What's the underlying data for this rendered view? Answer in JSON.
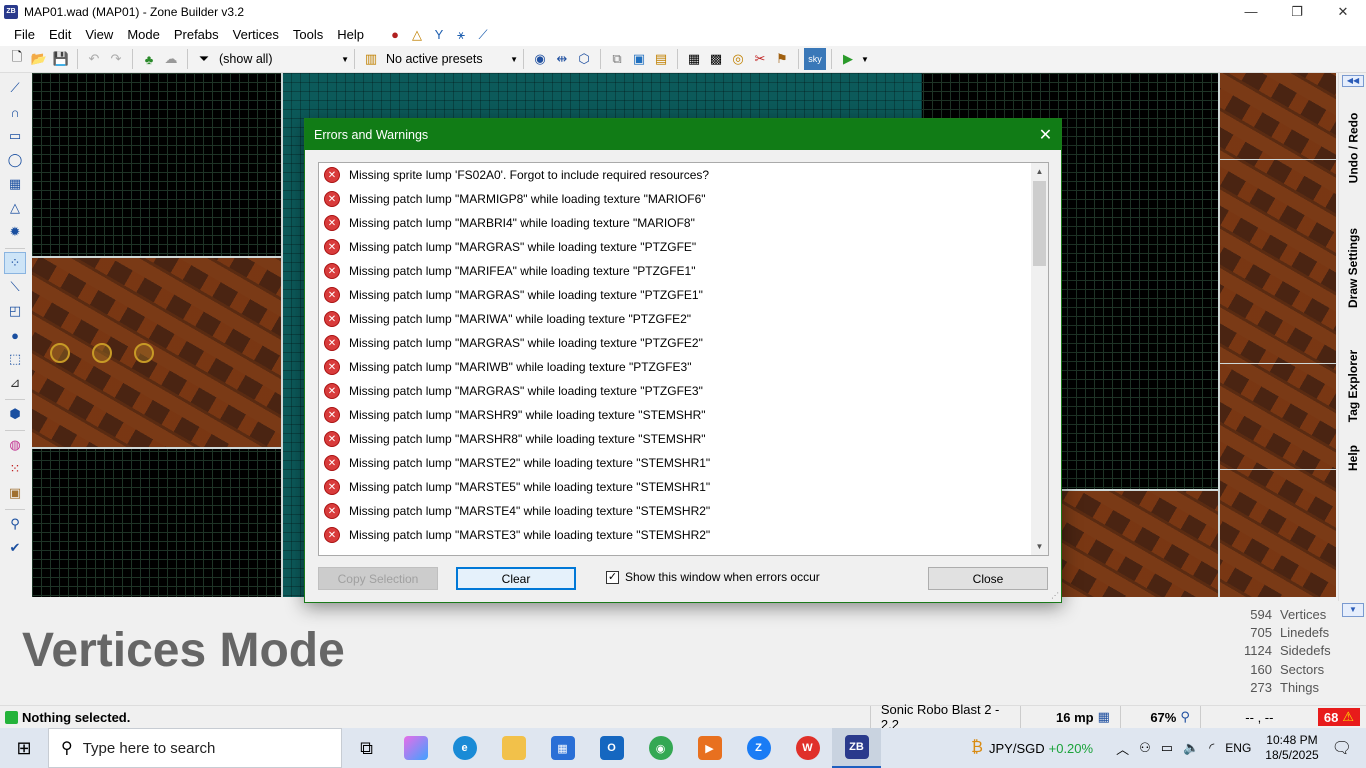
{
  "window": {
    "app_icon": "ZB",
    "title": "MAP01.wad (MAP01) - Zone Builder v3.2",
    "minimize": "—",
    "maximize": "❐",
    "close": "✕"
  },
  "menu": [
    "File",
    "Edit",
    "View",
    "Mode",
    "Prefabs",
    "Vertices",
    "Tools",
    "Help"
  ],
  "toolbar": {
    "filter_value": "(show all)",
    "preset_value": "No active presets"
  },
  "dialog": {
    "title": "Errors and Warnings",
    "close_glyph": "✕",
    "errors": [
      "Missing sprite lump 'FS02A0'. Forgot to include required resources?",
      "Missing patch lump \"MARMIGP8\" while loading texture \"MARIOF6\"",
      "Missing patch lump \"MARBRI4\" while loading texture \"MARIOF8\"",
      "Missing patch lump \"MARGRAS\" while loading texture \"PTZGFE\"",
      "Missing patch lump \"MARIFEA\" while loading texture \"PTZGFE1\"",
      "Missing patch lump \"MARGRAS\" while loading texture \"PTZGFE1\"",
      "Missing patch lump \"MARIWA\" while loading texture \"PTZGFE2\"",
      "Missing patch lump \"MARGRAS\" while loading texture \"PTZGFE2\"",
      "Missing patch lump \"MARIWB\" while loading texture \"PTZGFE3\"",
      "Missing patch lump \"MARGRAS\" while loading texture \"PTZGFE3\"",
      "Missing patch lump \"MARSHR9\" while loading texture \"STEMSHR\"",
      "Missing patch lump \"MARSHR8\" while loading texture \"STEMSHR\"",
      "Missing patch lump \"MARSTE2\" while loading texture \"STEMSHR1\"",
      "Missing patch lump \"MARSTE5\" while loading texture \"STEMSHR1\"",
      "Missing patch lump \"MARSTE4\" while loading texture \"STEMSHR2\"",
      "Missing patch lump \"MARSTE3\" while loading texture \"STEMSHR2\""
    ],
    "copy_label": "Copy Selection",
    "clear_label": "Clear",
    "show_label": "Show this window when errors occur",
    "show_checked": true,
    "close_label": "Close"
  },
  "dock_tabs": [
    "Undo / Redo",
    "Draw Settings",
    "Tag Explorer",
    "Help"
  ],
  "info": {
    "mode_title": "Vertices Mode",
    "stats": [
      {
        "value": "594",
        "label": "Vertices"
      },
      {
        "value": "705",
        "label": "Linedefs"
      },
      {
        "value": "1124",
        "label": "Sidedefs"
      },
      {
        "value": "160",
        "label": "Sectors"
      },
      {
        "value": "273",
        "label": "Things"
      }
    ]
  },
  "status": {
    "text": "Nothing selected.",
    "game": "Sonic Robo Blast 2 - 2.2",
    "grid": "16 mp",
    "zoom": "67%",
    "coords": "-- , --",
    "error_count": "68"
  },
  "taskbar": {
    "search_placeholder": "Type here to search",
    "currency_label": "JPY/SGD",
    "currency_change": "+0.20%",
    "lang": "ENG",
    "time": "10:48 PM",
    "date": "18/5/2025"
  },
  "colors": {
    "dialog_title_bg": "#117c16",
    "error_icon": "#d83b3b",
    "status_ok": "#24b33a",
    "currency_up": "#1aa33a"
  }
}
